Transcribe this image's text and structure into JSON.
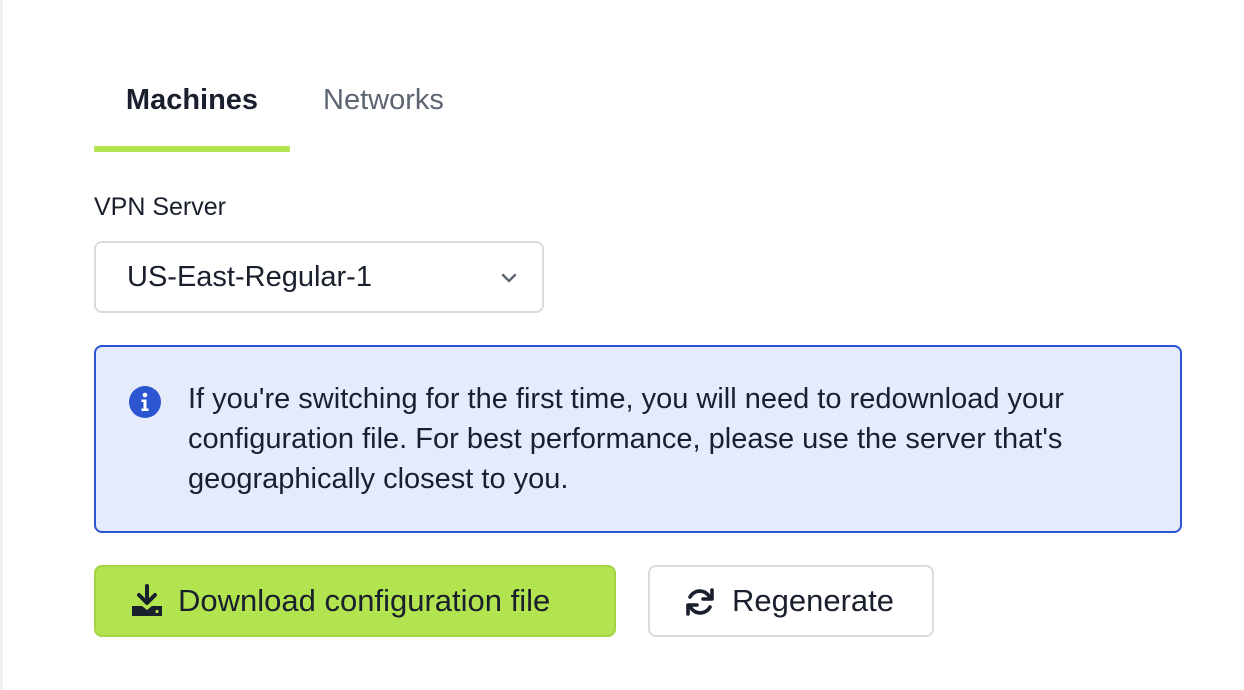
{
  "tabs": [
    {
      "label": "Machines",
      "active": true
    },
    {
      "label": "Networks",
      "active": false
    }
  ],
  "vpn_server": {
    "label": "VPN Server",
    "selected": "US-East-Regular-1"
  },
  "alert": {
    "icon": "info-icon",
    "text": "If you're switching for the first time, you will need to redownload your configuration file. For best performance, please use the server that's geographically closest to you."
  },
  "actions": {
    "download_label": "Download configuration file",
    "download_icon": "download-icon",
    "regenerate_label": "Regenerate",
    "regenerate_icon": "refresh-icon"
  },
  "colors": {
    "accent": "#b2e44f",
    "info_border": "#2b55d1",
    "info_background": "#e5ebfa"
  }
}
